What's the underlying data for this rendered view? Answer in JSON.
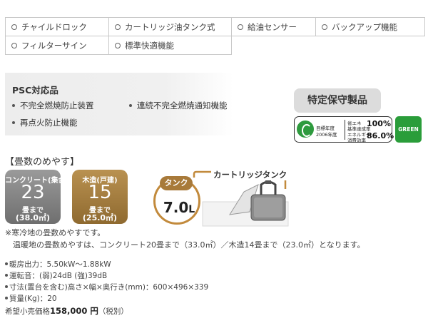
{
  "features": {
    "row1": [
      "チャイルドロック",
      "カートリッジ油タンク式",
      "給油センサー",
      "バックアップ機能"
    ],
    "row2": [
      "フィルターサイン",
      "標準快適機能"
    ]
  },
  "psc": {
    "title": "PSC対応品",
    "items": [
      "不完全燃焼防止装置",
      "連続不完全燃焼通知機能",
      "再点火防止機能"
    ]
  },
  "badges": {
    "tokutei": "特定保守製品",
    "energy": {
      "target_year_line1": "目標年度",
      "target_year_line2": "2006年度",
      "standard_label_line1": "省エネ",
      "standard_label_line2": "基準達成率",
      "standard_value": "100%",
      "efficiency_label_line1": "エネルギー",
      "efficiency_label_line2": "消費効率",
      "efficiency_value": "86.0%"
    },
    "green": "GREEN"
  },
  "tatami": {
    "heading": "【畳数のめやす】",
    "concrete": {
      "type": "コンクリート(集合)",
      "value": "23",
      "made": "畳まで",
      "area": "(38.0㎡)"
    },
    "wood": {
      "type": "木造(戸建)",
      "value": "15",
      "made": "畳まで",
      "area": "(25.0㎡)"
    }
  },
  "tank": {
    "tag": "タンク",
    "capacity_value": "7.0",
    "capacity_unit": "L",
    "type_label": "カートリッジタンク"
  },
  "notes": {
    "line1": "※寒冷地の畳数めやすです。",
    "line2": "温暖地の畳数めやすは、コンクリート20畳まで（33.0㎡）／木造14畳まで（23.0㎡）となります。"
  },
  "specs": [
    "暖房出力：5.50kW～1.88kW",
    "運転音：(弱)24dB (強)39dB",
    "寸法(置台を含む)高さ×幅×奥行き(mm)：600×496×339",
    "質量(Kg)：20"
  ],
  "price": {
    "label": "希望小売価格",
    "amount": "158,000 円",
    "tax": "（税別）"
  },
  "colors": {
    "concrete_card": "#7f7f7f",
    "wood_card": "#a07a3e",
    "green_badge": "#2a9d3a",
    "tank_ring": "#c28a3c"
  }
}
